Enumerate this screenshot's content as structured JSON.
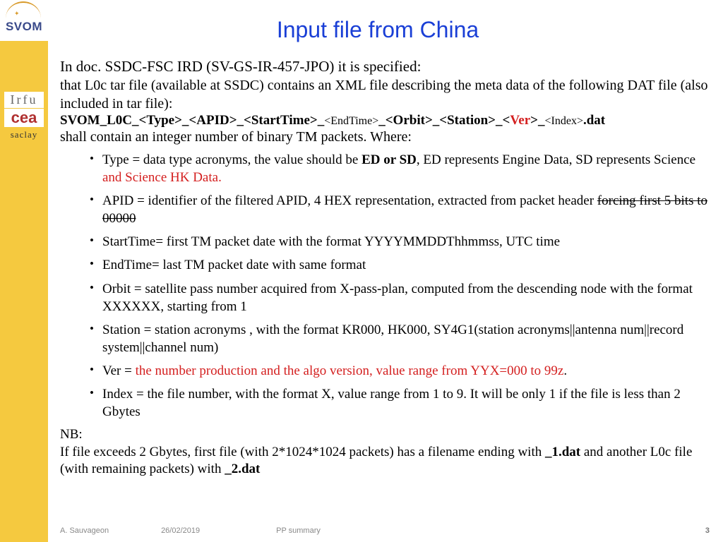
{
  "logos": {
    "svom_text": "SVOM",
    "irfu_text": "Irfu",
    "cea_text": "cea",
    "saclay_text": "saclay"
  },
  "title": "Input file from China",
  "intro": "In doc. SSDC-FSC IRD (SV-GS-IR-457-JPO) it is specified:",
  "intro2": "that L0c tar file (available at SSDC) contains an XML file describing the meta data of the following DAT file (also included in tar file):",
  "fname": {
    "p1": "SVOM_L0C_<Type>_<APID>_<StartTime>_",
    "et": "<EndTime>",
    "p2": "_<Orbit>_<Station>_<",
    "ver": "Ver",
    "p3": ">_",
    "idx": "<Index>",
    "p4": ".dat"
  },
  "intro3": "shall contain an integer number of binary TM packets. Where:",
  "bullets": {
    "b1a": "Type = data type acronyms, the value should be ",
    "b1b": "ED or SD",
    "b1c": ", ED represents Engine Data, SD represents Science ",
    "b1d": "and Science HK Data.",
    "b2a": "APID = identifier of the filtered APID, 4 HEX representation, extracted from packet header ",
    "b2b": "forcing first 5 bits to 00000",
    "b3": "StartTime= first TM packet date with the format YYYYMMDDThhmmss, UTC time",
    "b4": "EndTime= last TM packet date with same format",
    "b5": "Orbit = satellite pass number acquired from X-pass-plan, computed from the descending node with the format XXXXXX, starting from 1",
    "b6": "Station = station acronyms , with the format KR000, HK000, SY4G1(station acronyms||antenna num||record system||channel num)",
    "b7a": "Ver = ",
    "b7b": "the number production and the algo version, value range from YYX=000 to 99z",
    "b7c": ".",
    "b8": "Index = the file number, with the format X, value range from 1 to 9. It will be only 1 if the file is less than 2 Gbytes"
  },
  "nb_label": "NB:",
  "nb_a": "If file exceeds 2 Gbytes, first file (with 2*1024*1024 packets) has a filename ending with ",
  "nb_b": "_1.dat",
  "nb_c": " and another L0c file (with remaining packets) with ",
  "nb_d": "_2.dat",
  "footer": {
    "author": "A. Sauvageon",
    "date": "26/02/2019",
    "project": "PP summary",
    "page": "3"
  }
}
